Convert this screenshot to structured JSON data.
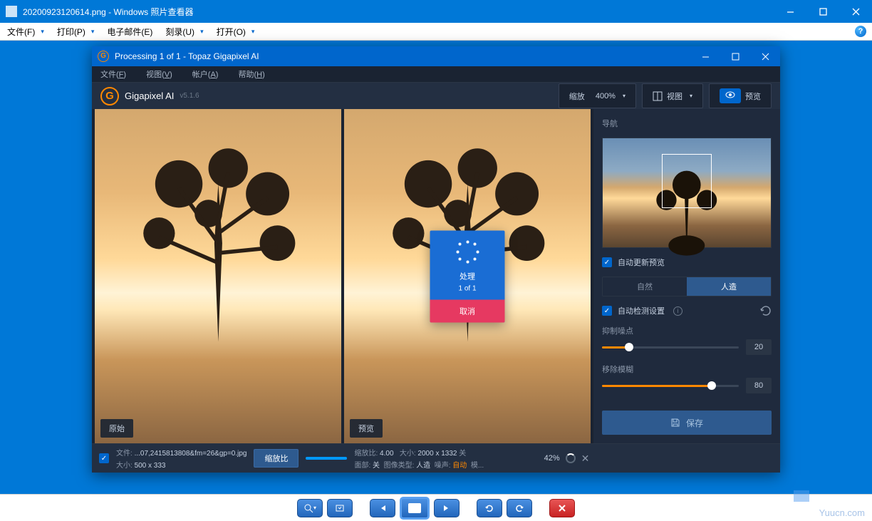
{
  "outer": {
    "title": "20200923120614.png - Windows 照片查看器",
    "menu": {
      "file": "文件(F)",
      "print": "打印(P)",
      "email": "电子邮件(E)",
      "burn": "刻录(U)",
      "open": "打开(O)"
    }
  },
  "inner": {
    "title": "Processing 1 of 1 - Topaz Gigapixel AI",
    "menu": {
      "file": "文件(F)",
      "view": "视图(V)",
      "account": "帐户(A)",
      "help": "帮助(H)"
    },
    "app_name": "Gigapixel AI",
    "version": "v5.1.6",
    "toolbar": {
      "zoom_label": "缩放",
      "zoom_value": "400%",
      "view_label": "视图",
      "preview_label": "预览"
    },
    "panels": {
      "original": "原始",
      "preview": "预览"
    },
    "processing": {
      "label": "处理",
      "count": "1 of 1",
      "cancel": "取消"
    },
    "right": {
      "nav_label": "导航",
      "auto_preview": "自动更新预览",
      "mode_natural": "自然",
      "mode_artificial": "人造",
      "auto_detect": "自动检测设置",
      "suppress_noise": "抑制噪点",
      "suppress_noise_val": "20",
      "remove_blur": "移除模糊",
      "remove_blur_val": "80",
      "save_label": "保存"
    },
    "bottom": {
      "file_label": "文件:",
      "file_name": "...07,2415813808&fm=26&gp=0.jpg",
      "size_label": "大小:",
      "size_value": "500 x 333",
      "scale_btn": "缩放比",
      "ratio_label": "缩放比:",
      "ratio_value": "4.00",
      "outsize_label": "大小:",
      "outsize_value": "2000 x 1332",
      "face_label": "面部:",
      "face_value": "关",
      "type_label": "图像类型:",
      "type_value": "人造",
      "noise_label": "噪声:",
      "auto_label": "自动",
      "blur_label": "模...",
      "progress": "42%"
    }
  },
  "watermark": "Yuucn.com"
}
